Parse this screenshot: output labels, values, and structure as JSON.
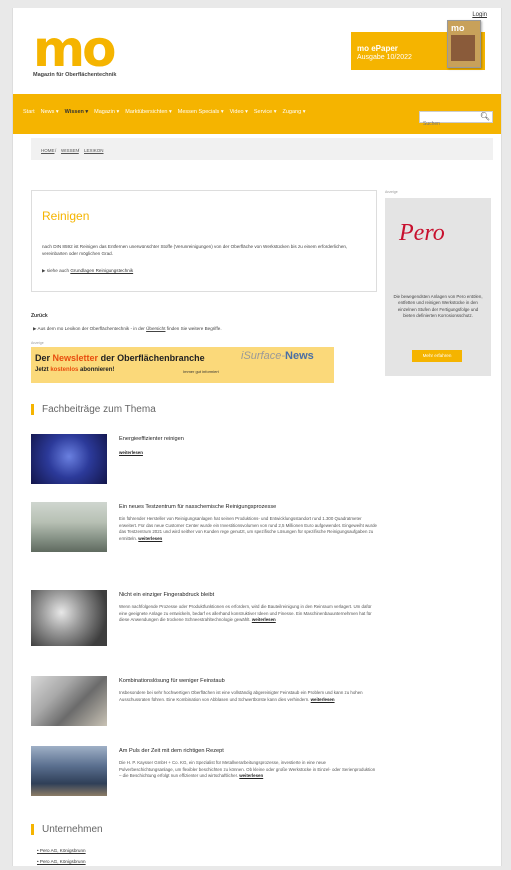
{
  "header": {
    "login": "Login",
    "logo_main": "mo",
    "logo_sub": "Magazin für Oberflächentechnik",
    "epaper_title": "mo ePaper",
    "epaper_issue": "Ausgabe 10/2022",
    "epaper_cover_logo": "mo"
  },
  "nav": {
    "items": [
      "Start",
      "News ▾",
      "Wissen ▾",
      "Magazin ▾",
      "Marktübersichten ▾",
      "Messen Specials ▾",
      "Video ▾",
      "Service ▾",
      "Zugang ▾"
    ],
    "search_placeholder": "Suchen"
  },
  "breadcrumb": {
    "items": [
      "HOME",
      "WISSEN",
      "LEXIKON"
    ],
    "separator": "/"
  },
  "definition": {
    "title": "Reinigen",
    "text": "nach DIN 8592 ist Reinigen das Entfernen unerwünschter Stoffe (Verunreinigungen) von der Oberfläche von Werkstücken bis zu einem erforderlichen, vereinbarten oder möglichen Grad.",
    "see_also_prefix": "▶ siehe auch",
    "see_also_link": "Grundlagen Reinigungstechnik"
  },
  "back": "Zurück",
  "lexikon_hint": {
    "prefix": "▶ Aus dem mo Lexikon der Oberflächentechnik - in der",
    "link": "Übersicht",
    "suffix": "finden Sie weitere Begriffe."
  },
  "ad_label": "Anzeige",
  "newsletter": {
    "line1_a": "Der",
    "line1_b": "Newsletter",
    "line1_c": "der Oberflächenbranche",
    "line2_a": "Jetzt",
    "line2_b": "kostenlos",
    "line2_c": "abonnieren!",
    "line3": "Immer gut informiert",
    "brand_a": "iSurface-",
    "brand_b": "News"
  },
  "section_articles": "Fachbeiträge zum Thema",
  "more": "weiterlesen",
  "articles": [
    {
      "title": "Energieeffizienter reinigen",
      "text": ""
    },
    {
      "title": "Ein neues Testzentrum für nasschemische Reinigungsprozesse",
      "text": "Ein führender Hersteller von Reinigungsanlagen hat seinen Produktions- und Entwicklungsstandort rund 1.300 Quadratmeter erweitert. Für das neue Customer Center wurde ein Investitionsvolumen von rund 2,5 Millionen Euro aufgewendet. Eingeweiht wurde das Testzentrum 2021 und wird seither von Kunden rege genutzt, um spezifische Lösungen für spezifische Reinigungsaufgaben zu ermitteln."
    },
    {
      "title": "Nicht ein einziger Fingerabdruck bleibt",
      "text": "Wenn nachfolgende Prozesse oder Produktfunktionen es erfordern, wird die Bauteilreinigung in den Reinraum verlagert. Um dafür eine geeignete Anlage zu entwickeln, bedarf es allerhand konstruktiver Ideen und Finesse. Ein Maschinenbauunternehmen hat für diese Anwendungen die trockene Schneestrahltechnologie gewählt."
    },
    {
      "title": "Kombinationslösung für weniger Feinstaub",
      "text": "Insbesondere bei sehr hochwertigen Oberflächen ist eine vollständig abgereinigter Feinstaub ein Problem und kann zu hohen Ausschussraten führen. Eine Kombination von Abblasen und Schwertbürste kann dies verhindern."
    },
    {
      "title": "Am Puls der Zeit mit dem richtigen Rezept",
      "text": "Die H. P. Kaysser GmbH + Co. KG, ein Spezialist für Metallverarbeitungsprozesse, investierte in eine neue Pulverbeschichtungsanlage, um flexibler beschichten zu können. Ob kleine oder große Werkstücke in Einzel- oder Serienproduktion – die Beschichtung erfolgt nun effizienter und wirtschaftlicher."
    }
  ],
  "section_companies": "Unternehmen",
  "companies": [
    "Pero AG, Königsbrunn",
    "Pero AG, Königsbrunn"
  ],
  "sidebar": {
    "ad_label": "Anzeige",
    "brand": "Pero",
    "text": "Die bewegendsten Anlagen von Pero entölen, entfetten und reinigen Werkstücke in den einzelnen Stufen der Fertigungsfolge und bieten definierten Korrosionsschutz.",
    "button": "Mehr erfahren"
  },
  "colors": {
    "accent": "#f5b400",
    "brand_red": "#c8102e",
    "newsletter_red": "#e84d0e"
  }
}
